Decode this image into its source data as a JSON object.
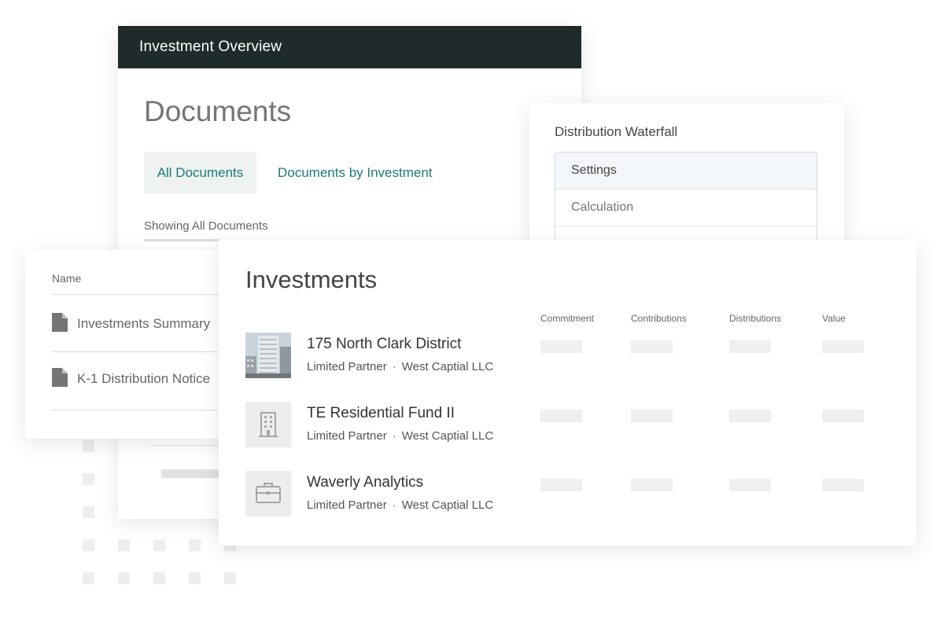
{
  "documents_panel": {
    "header_title": "Investment Overview",
    "page_title": "Documents",
    "tabs": [
      {
        "label": "All Documents",
        "active": true
      },
      {
        "label": "Documents by Investment",
        "active": false
      }
    ],
    "filter_status": "Showing All Documents"
  },
  "waterfall_panel": {
    "title": "Distribution Waterfall",
    "items": [
      {
        "label": "Settings",
        "selected": true
      },
      {
        "label": "Calculation",
        "selected": false
      }
    ]
  },
  "documents_table": {
    "column_header": "Name",
    "rows": [
      {
        "label": "Investments Summary",
        "icon": "file-icon"
      },
      {
        "label": "K-1 Distribution Notice",
        "icon": "file-icon"
      }
    ]
  },
  "investments_panel": {
    "title": "Investments",
    "columns": [
      "Commitment",
      "Contributions",
      "Distributions",
      "Value"
    ],
    "rows": [
      {
        "name": "175 North Clark District",
        "role": "Limited Partner",
        "separator": "·",
        "entity": "West Captial LLC",
        "thumbnail": "building-photo"
      },
      {
        "name": "TE Residential Fund II",
        "role": "Limited Partner",
        "separator": "·",
        "entity": "West Captial LLC",
        "thumbnail": "building-icon"
      },
      {
        "name": "Waverly Analytics",
        "role": "Limited Partner",
        "separator": "·",
        "entity": "West Captial LLC",
        "thumbnail": "briefcase-icon"
      }
    ]
  },
  "colors": {
    "header_bg": "#1f2b2a",
    "accent_teal": "#1d7a77",
    "tab_active_bg": "#eef3f1",
    "placeholder": "#efefef"
  }
}
